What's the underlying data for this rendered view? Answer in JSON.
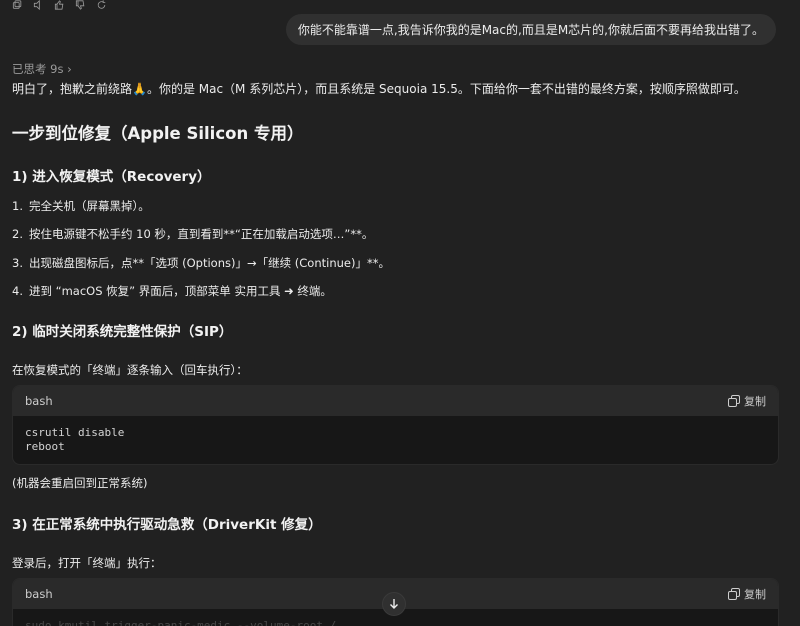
{
  "message": {
    "user_text": "你能不能靠谱一点,我告诉你我的是Mac的,而且是M芯片的,你就后面不要再给我出错了。",
    "thought_label": "已思考 9s ›",
    "intro": "明白了，抱歉之前绕路🙏。你的是 Mac（M 系列芯片），而且系统是 Sequoia 15.5。下面给你一套不出错的最终方案，按顺序照做即可。"
  },
  "article": {
    "title": "一步到位修复（Apple Silicon 专用）",
    "section1": {
      "heading": "1) 进入恢复模式（Recovery）",
      "items": [
        {
          "num": "1.",
          "text": "完全关机（屏幕黑掉）。"
        },
        {
          "num": "2.",
          "text": "按住电源键不松手约 10 秒，直到看到**“正在加载启动选项…”**。"
        },
        {
          "num": "3.",
          "text": "出现磁盘图标后，点**「选项 (Options)」→「继续 (Continue)」**。"
        },
        {
          "num": "4.",
          "text": "进到 “macOS 恢复” 界面后，顶部菜单 实用工具 ➜ 终端。"
        }
      ]
    },
    "section2": {
      "heading": "2) 临时关闭系统完整性保护（SIP）",
      "para": "在恢复模式的「终端」逐条输入（回车执行）：",
      "code_lang": "bash",
      "code": "csrutil disable\nreboot",
      "after": "(机器会重启回到正常系统)"
    },
    "section3": {
      "heading": "3) 在正常系统中执行驱动急救（DriverKit 修复）",
      "para": "登录后，打开「终端」执行：",
      "code_lang": "bash",
      "code": "sudo kmutil trigger-panic-medic --volume-root /"
    }
  },
  "ui": {
    "copy_label": "复制"
  }
}
